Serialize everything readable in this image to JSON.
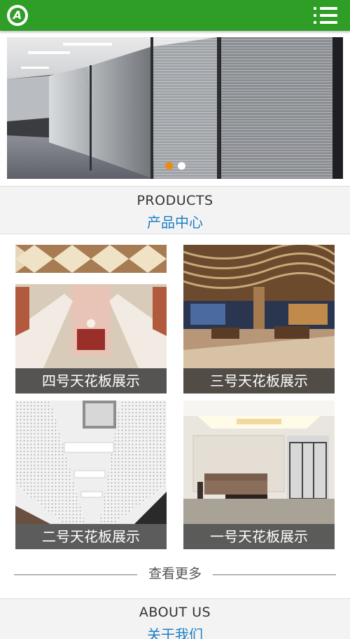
{
  "header": {
    "logo_letter": "A",
    "brand_color": "#2f9e27",
    "menu_icon": "hamburger-list-icon"
  },
  "banner": {
    "slide_count": 2,
    "active_slide": 1,
    "indicator_active_color": "#e98d14"
  },
  "products": {
    "title_en": "PRODUCTS",
    "title_cn": "产品中心",
    "items": [
      {
        "label": "四号天花板展示"
      },
      {
        "label": "三号天花板展示"
      },
      {
        "label": "二号天花板展示"
      },
      {
        "label": "一号天花板展示"
      }
    ],
    "more_label": "查看更多"
  },
  "about": {
    "title_en": "ABOUT US",
    "title_cn": "关于我们"
  },
  "colors": {
    "link_blue": "#1b7fc4",
    "section_bg": "#f3f3f3"
  }
}
